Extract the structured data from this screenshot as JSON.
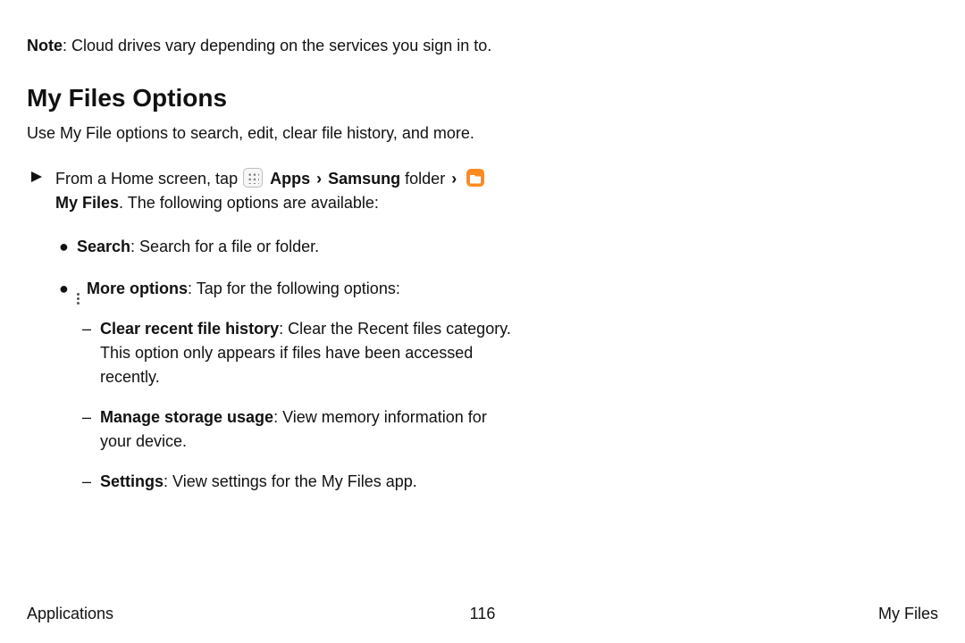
{
  "note": {
    "label": "Note",
    "text": ": Cloud drives vary depending on the services you sign in to."
  },
  "heading": "My Files Options",
  "subhead": "Use My File options to search, edit, clear file history, and more.",
  "step": {
    "pre": "From a Home screen, tap ",
    "apps": "Apps",
    "samsung": "Samsung",
    "folder_word": " folder ",
    "myfiles": "My Files",
    "post": ". The following options are available:"
  },
  "bullets": {
    "search": {
      "title": "Search",
      "text": ": Search for a file or folder."
    },
    "more": {
      "title": "More options",
      "text": ": Tap for the following options:",
      "sub": {
        "clear": {
          "title": "Clear recent file history",
          "text": ": Clear the Recent files category. This option only appears if files have been accessed recently."
        },
        "manage": {
          "title": "Manage storage usage",
          "text": ": View memory information for your device."
        },
        "settings": {
          "title": "Settings",
          "text": ": View settings for the My Files app."
        }
      }
    }
  },
  "footer": {
    "left": "Applications",
    "page": "116",
    "right": "My Files"
  }
}
